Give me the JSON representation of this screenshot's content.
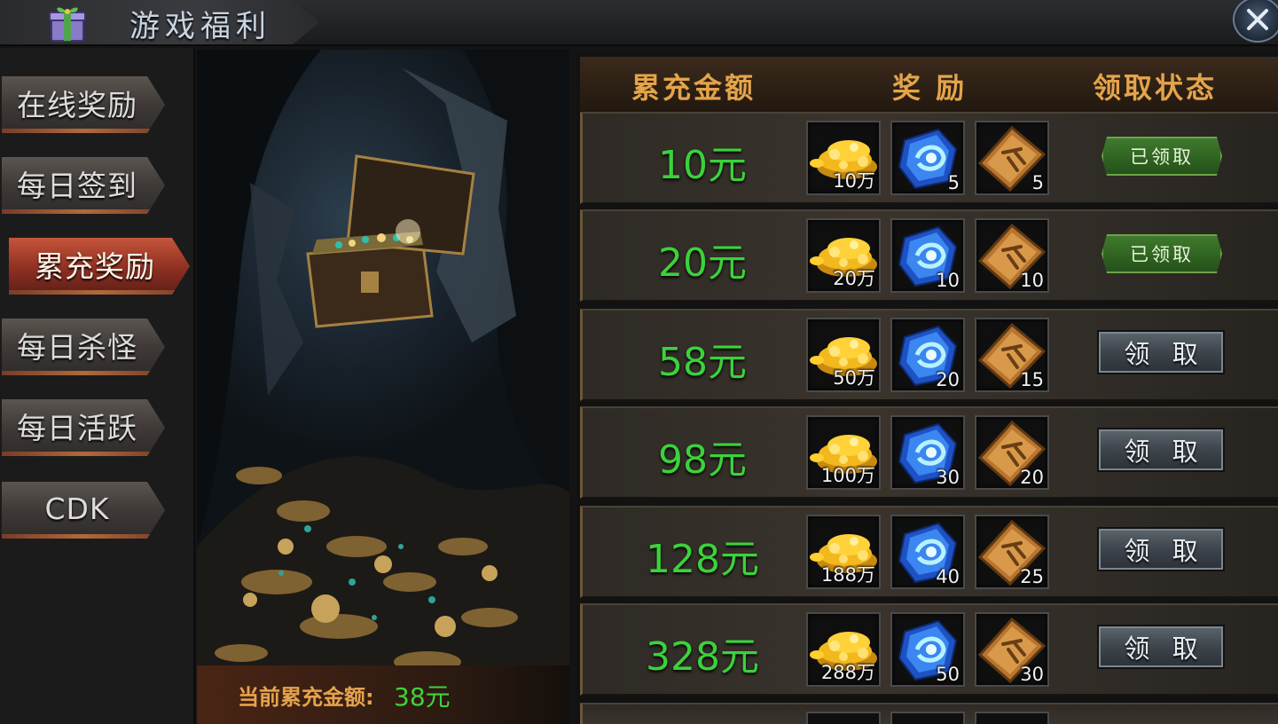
{
  "header": {
    "title": "游戏福利",
    "close_icon": "close-icon",
    "gift_icon": "gift-box-icon"
  },
  "sidebar": {
    "items": [
      {
        "label": "在线奖励",
        "active": false
      },
      {
        "label": "每日签到",
        "active": false
      },
      {
        "label": "累充奖励",
        "active": true
      },
      {
        "label": "每日杀怪",
        "active": false
      },
      {
        "label": "每日活跃",
        "active": false
      },
      {
        "label": "CDK",
        "active": false
      }
    ]
  },
  "picture": {
    "subject": "treasure-chest-in-cave",
    "current_label": "当前累充金额:",
    "current_value": "38元"
  },
  "table": {
    "headers": {
      "amount": "累充金额",
      "reward": "奖 励",
      "status": "领取状态"
    },
    "rows": [
      {
        "amount": "10元",
        "gold": "10万",
        "crystal": "5",
        "scroll": "5",
        "status": "claimed",
        "status_label": "已领取"
      },
      {
        "amount": "20元",
        "gold": "20万",
        "crystal": "10",
        "scroll": "10",
        "status": "claimed",
        "status_label": "已领取"
      },
      {
        "amount": "58元",
        "gold": "50万",
        "crystal": "20",
        "scroll": "15",
        "status": "claim",
        "status_label": "领 取"
      },
      {
        "amount": "98元",
        "gold": "100万",
        "crystal": "30",
        "scroll": "20",
        "status": "claim",
        "status_label": "领 取"
      },
      {
        "amount": "128元",
        "gold": "188万",
        "crystal": "40",
        "scroll": "25",
        "status": "claim",
        "status_label": "领 取"
      },
      {
        "amount": "328元",
        "gold": "288万",
        "crystal": "50",
        "scroll": "30",
        "status": "claim",
        "status_label": "领 取"
      }
    ],
    "item_icons": [
      "gold-coins-icon",
      "blue-crystal-icon",
      "bronze-scroll-icon"
    ]
  },
  "colors": {
    "amount_green": "#3bd23b",
    "header_gold": "#e4a44a",
    "active_tab": "#c6553a",
    "claimed_green": "#3f7a2c"
  }
}
